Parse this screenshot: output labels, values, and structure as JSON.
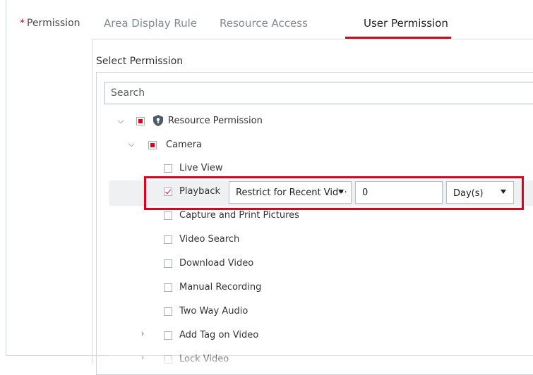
{
  "permission_label": "Permission",
  "required_mark": "*",
  "tabs": [
    {
      "label": "Area Display Rule"
    },
    {
      "label": "Resource Access"
    },
    {
      "label": "User Permission"
    }
  ],
  "select_title": "Select Permission",
  "search": {
    "placeholder": "Search"
  },
  "tree": {
    "root": {
      "label": "Resource Permission",
      "state": "partial",
      "expanded": true
    },
    "camera": {
      "label": "Camera",
      "state": "partial",
      "expanded": true
    },
    "items": [
      {
        "label": "Live View",
        "checked": false
      },
      {
        "label": "Playback",
        "checked": true
      },
      {
        "label": "Capture and Print Pictures",
        "checked": false
      },
      {
        "label": "Video Search",
        "checked": false
      },
      {
        "label": "Download Video",
        "checked": false
      },
      {
        "label": "Manual Recording",
        "checked": false
      },
      {
        "label": "Two Way Audio",
        "checked": false
      },
      {
        "label": "Add Tag on Video",
        "checked": false,
        "expandable": true
      },
      {
        "label": "Lock Video",
        "checked": false,
        "expandable": true
      }
    ]
  },
  "playback_controls": {
    "restrict_select": "Restrict for Recent Vid···",
    "days_value": "0",
    "unit_select": "Day(s)"
  },
  "colors": {
    "accent": "#e0001b",
    "highlight_row": "#eef0f2"
  }
}
